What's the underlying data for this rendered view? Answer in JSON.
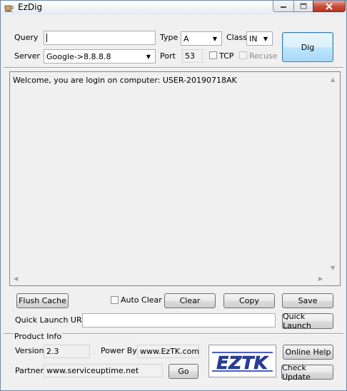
{
  "window": {
    "title": "EzDig"
  },
  "query": {
    "label": "Query",
    "value": ""
  },
  "type": {
    "label": "Type",
    "value": "A"
  },
  "class": {
    "label": "Class",
    "value": "IN"
  },
  "server": {
    "label": "Server",
    "value": "Google->8.8.8.8"
  },
  "port": {
    "label": "Port",
    "value": "53"
  },
  "tcp": {
    "label": "TCP",
    "checked": false
  },
  "recuse": {
    "label": "Recuse",
    "checked": false,
    "enabled": false
  },
  "dig_button": "Dig",
  "output": {
    "text": "Welcome, you are login on computer: USER-20190718AK"
  },
  "actions": {
    "flush_cache": "Flush Cache",
    "auto_clear": "Auto Clear",
    "clear": "Clear",
    "copy": "Copy",
    "save": "Save"
  },
  "quick_launch": {
    "label": "Quick Launch URL",
    "value": "",
    "button": "Quick Launch"
  },
  "product_info": {
    "heading": "Product Info",
    "version_label": "Version",
    "version": "2.3",
    "power_by_label": "Power By",
    "power_by": "www.EzTK.com",
    "partner_label": "Partner",
    "partner": "www.serviceuptime.net",
    "go_button": "Go",
    "logo_text": "EZTK",
    "online_help": "Online Help",
    "check_update": "Check Update"
  },
  "colors": {
    "accent": "#3c7fb1",
    "logo_blue": "#2a3e9c",
    "close_red": "#c9503e"
  }
}
